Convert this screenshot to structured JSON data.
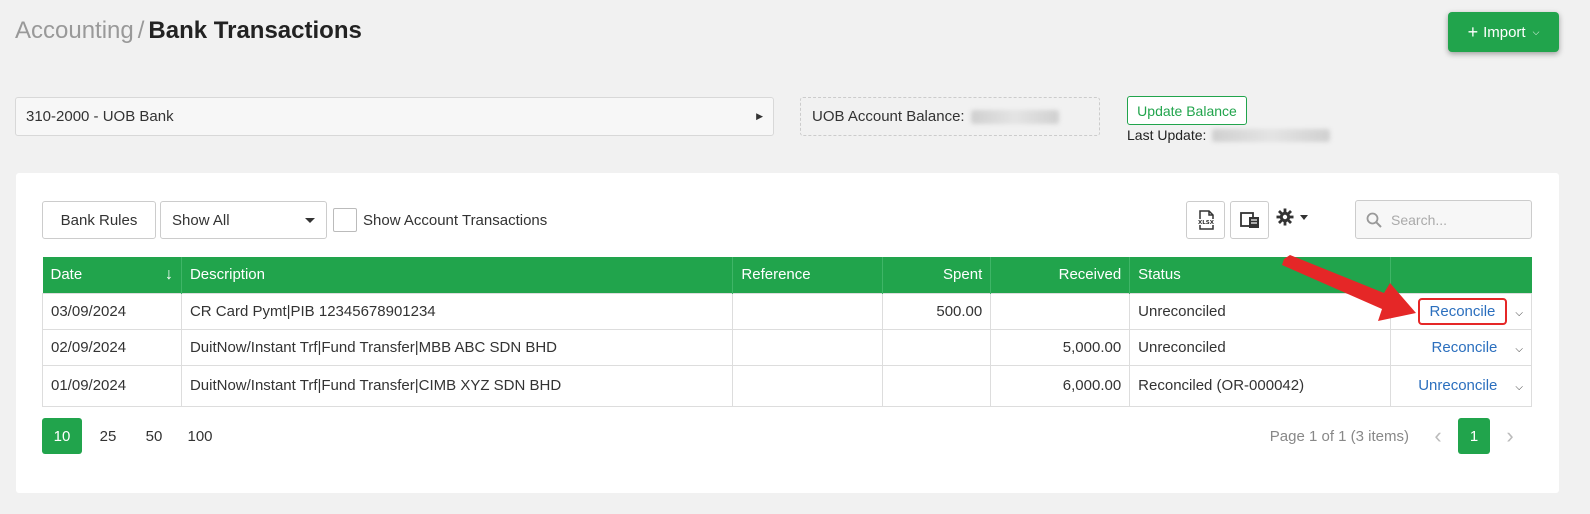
{
  "breadcrumb": {
    "parent": "Accounting",
    "separator": "/",
    "current": "Bank Transactions"
  },
  "header": {
    "import_label": "Import"
  },
  "account": {
    "selected": "310-2000 - UOB Bank"
  },
  "balance": {
    "label": "UOB Account Balance:"
  },
  "update": {
    "button_label": "Update Balance",
    "last_update_label": "Last Update:"
  },
  "toolbar": {
    "bank_rules_label": "Bank Rules",
    "filter_selected": "Show All",
    "show_account_tx_label": "Show Account Transactions",
    "search_placeholder": "Search..."
  },
  "table": {
    "columns": [
      "Date",
      "Description",
      "Reference",
      "Spent",
      "Received",
      "Status",
      ""
    ],
    "rows": [
      {
        "date": "03/09/2024",
        "description": "CR Card Pymt|PIB 12345678901234",
        "reference": "",
        "spent": "500.00",
        "received": "",
        "status": "Unreconciled",
        "action": "Reconcile"
      },
      {
        "date": "02/09/2024",
        "description": "DuitNow/Instant Trf|Fund Transfer|MBB ABC SDN BHD",
        "reference": "",
        "spent": "",
        "received": "5,000.00",
        "status": "Unreconciled",
        "action": "Reconcile"
      },
      {
        "date": "01/09/2024",
        "description": "DuitNow/Instant Trf|Fund Transfer|CIMB XYZ SDN BHD",
        "reference": "",
        "spent": "",
        "received": "6,000.00",
        "status": "Reconciled (OR-000042)",
        "action": "Unreconcile"
      }
    ]
  },
  "pagination": {
    "sizes": [
      "10",
      "25",
      "50",
      "100"
    ],
    "active_size": "10",
    "info": "Page 1 of 1 (3 items)",
    "current_page": "1"
  },
  "colors": {
    "brand_green": "#21a44c",
    "danger_red": "#e52727",
    "link_blue": "#2b6fbe"
  }
}
